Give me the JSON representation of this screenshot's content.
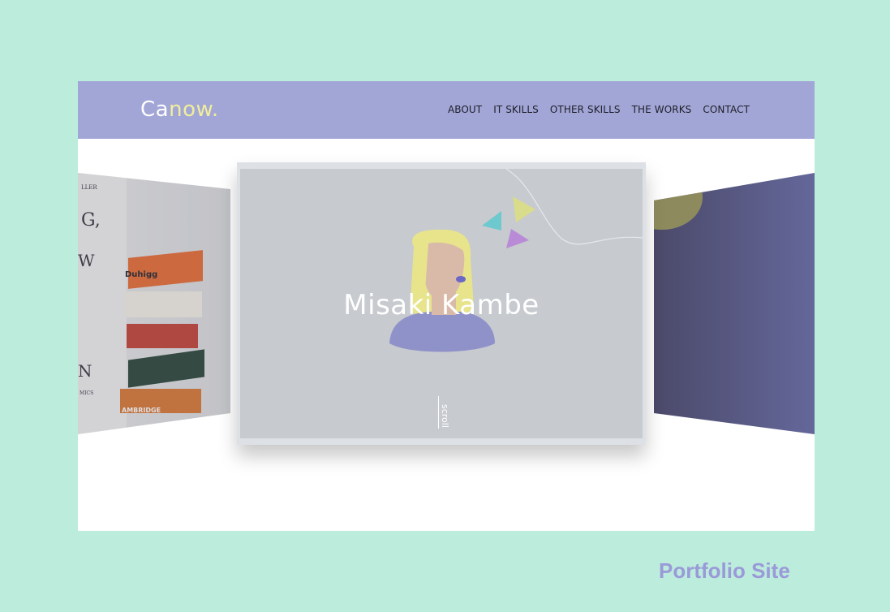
{
  "header": {
    "logo": {
      "part1": "Ca",
      "part2": "now."
    },
    "nav": [
      "ABOUT",
      "IT SKILLS",
      "OTHER SKILLS",
      "THE WORKS",
      "CONTACT"
    ]
  },
  "hero": {
    "title": "Misaki Kambe",
    "scroll_label": "scroll"
  },
  "left_slide": {
    "letters": [
      "LLER",
      "G,",
      "W",
      "N",
      "MICS"
    ],
    "book_labels": [
      "Duhigg",
      "AMBRIDGE"
    ]
  },
  "caption": "Portfolio Site",
  "colors": {
    "background": "#bcecdc",
    "header": "#a2a6d6",
    "logo_accent": "#f0ee9b",
    "caption": "#9a9ad8"
  }
}
